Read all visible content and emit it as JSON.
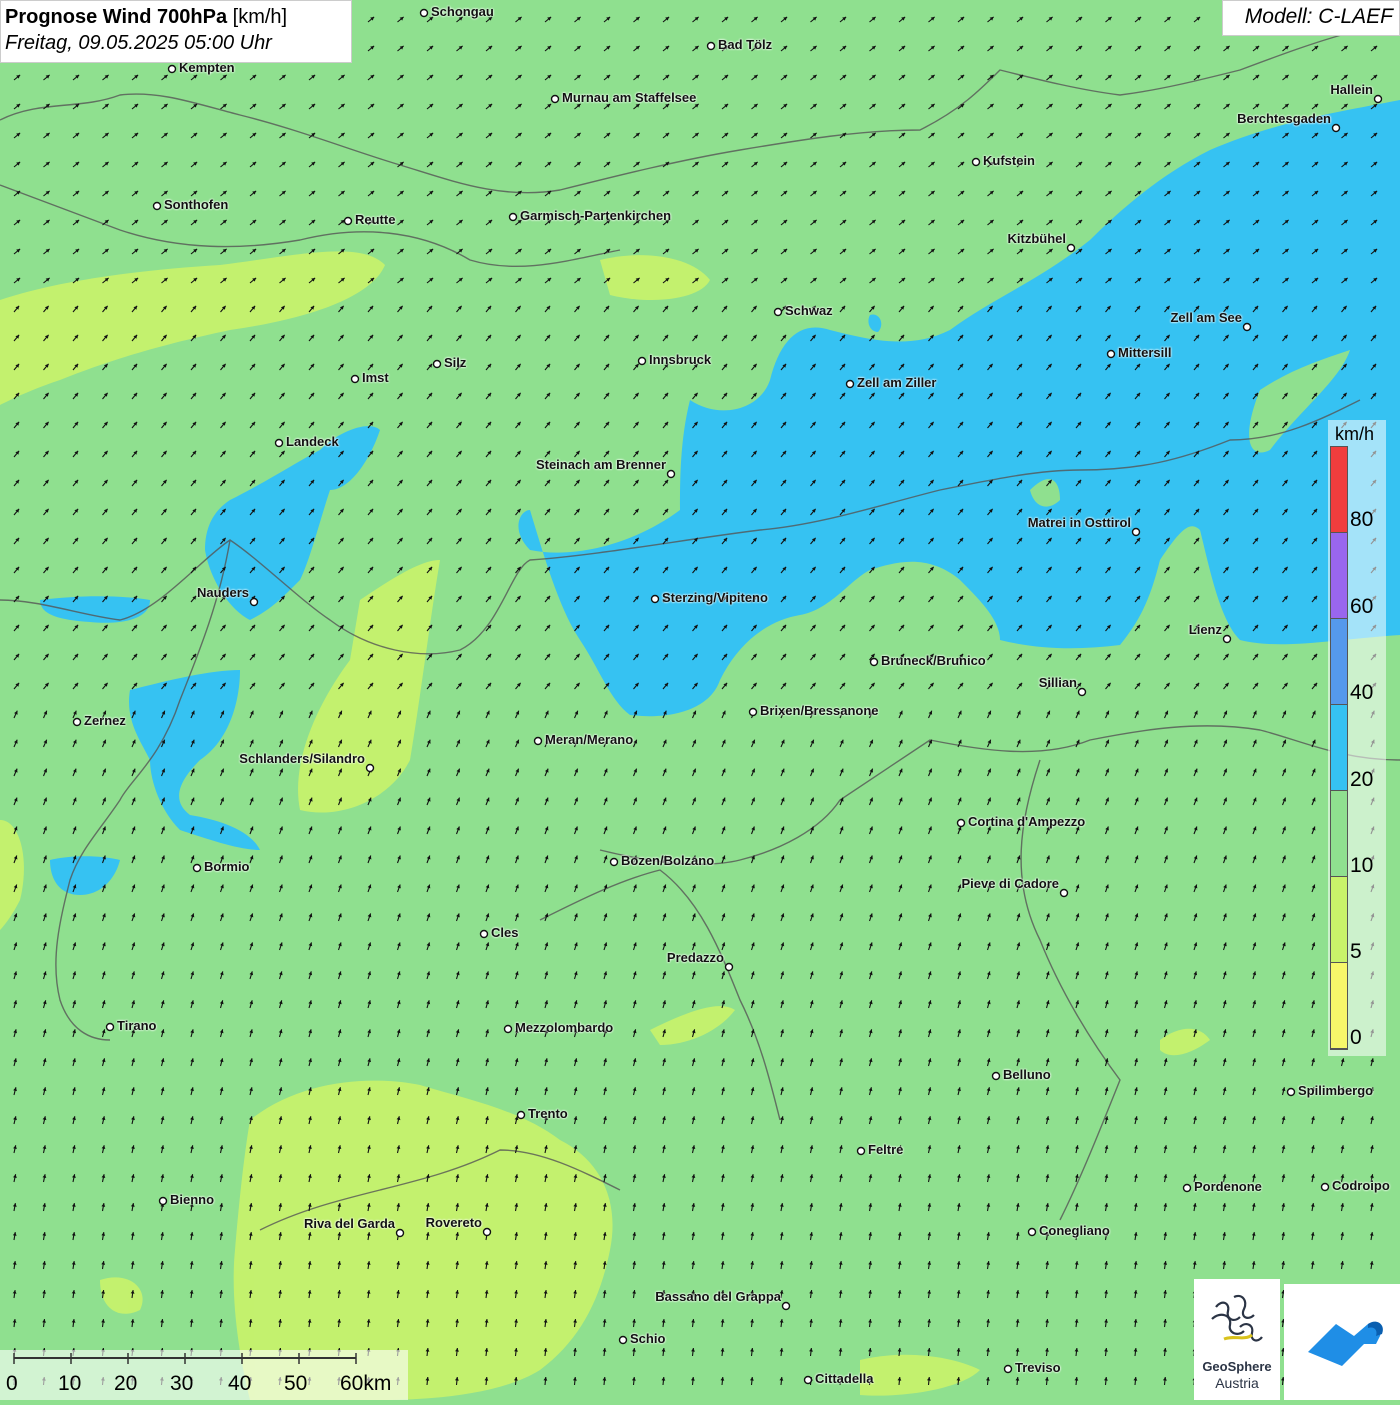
{
  "header": {
    "title_bold": "Prognose Wind 700hPa",
    "title_unit": "[km/h]",
    "subtitle": "Freitag, 09.05.2025 05:00 Uhr"
  },
  "model": "Modell: C-LAEF",
  "legend": {
    "unit": "km/h",
    "ticks": [
      "0",
      "5",
      "10",
      "20",
      "40",
      "60",
      "80"
    ],
    "colors": [
      "#f7f76a",
      "#c9f36a",
      "#8fe08f",
      "#36c2f2",
      "#5599ec",
      "#9966ee",
      "#f03d3d"
    ]
  },
  "scale": {
    "labels": [
      "0",
      "10",
      "20",
      "30",
      "40",
      "50",
      "60km"
    ]
  },
  "logos": {
    "geosphere_line1": "GeoSphere",
    "geosphere_line2": "Austria"
  },
  "colors": {
    "background": "#8fe08f",
    "wind_10_20": "#8fe08f",
    "wind_20_40": "#36c2f2",
    "wind_5_10": "#c9f36a",
    "arrow": "#111111",
    "border": "#555555"
  },
  "cities": [
    {
      "name": "Schongau"
    },
    {
      "name": "Bad Tölz"
    },
    {
      "name": "Kempten"
    },
    {
      "name": "Murnau am Staffelsee"
    },
    {
      "name": "Hallein"
    },
    {
      "name": "Berchtesgaden"
    },
    {
      "name": "Kufstein"
    },
    {
      "name": "Sonthofen"
    },
    {
      "name": "Reutte"
    },
    {
      "name": "Garmisch-Partenkirchen"
    },
    {
      "name": "Kitzbühel"
    },
    {
      "name": "Schwaz"
    },
    {
      "name": "Zell am See"
    },
    {
      "name": "Innsbruck"
    },
    {
      "name": "Silz"
    },
    {
      "name": "Mittersill"
    },
    {
      "name": "Imst"
    },
    {
      "name": "Zell am Ziller"
    },
    {
      "name": "Landeck"
    },
    {
      "name": "Steinach am Brenner"
    },
    {
      "name": "Matrei in Osttirol"
    },
    {
      "name": "Nauders"
    },
    {
      "name": "Sterzing/Vipiteno"
    },
    {
      "name": "Lienz"
    },
    {
      "name": "Bruneck/Brunico"
    },
    {
      "name": "Sillian"
    },
    {
      "name": "Zernez"
    },
    {
      "name": "Brixen/Bressanone"
    },
    {
      "name": "Meran/Merano"
    },
    {
      "name": "Schlanders/Silandro"
    },
    {
      "name": "Cortina d'Ampezzo"
    },
    {
      "name": "Bormio"
    },
    {
      "name": "Bozen/Bolzano"
    },
    {
      "name": "Pieve di Cadore"
    },
    {
      "name": "Cles"
    },
    {
      "name": "Predazzo"
    },
    {
      "name": "Tirano"
    },
    {
      "name": "Mezzolombardo"
    },
    {
      "name": "Belluno"
    },
    {
      "name": "Spilimbergo"
    },
    {
      "name": "Trento"
    },
    {
      "name": "Feltre"
    },
    {
      "name": "Pordenone"
    },
    {
      "name": "Codroipo"
    },
    {
      "name": "Bienno"
    },
    {
      "name": "Riva del Garda"
    },
    {
      "name": "Rovereto"
    },
    {
      "name": "Conegliano"
    },
    {
      "name": "Bassano del Grappa"
    },
    {
      "name": "Schio"
    },
    {
      "name": "Treviso"
    },
    {
      "name": "Cittadella"
    }
  ]
}
